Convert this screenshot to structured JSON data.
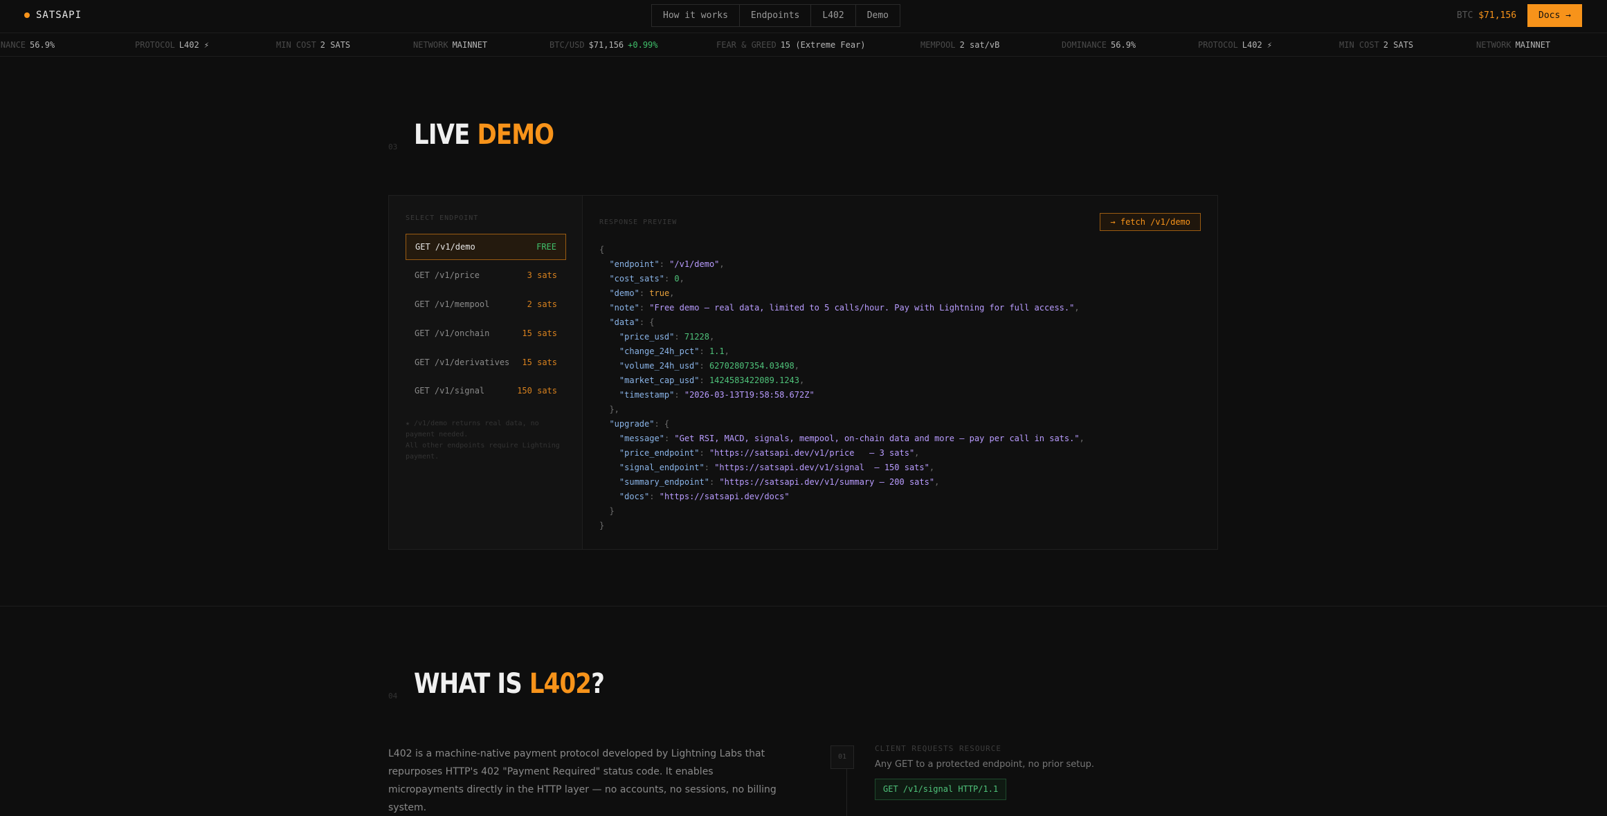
{
  "nav": {
    "brand": "SATSAPI",
    "links": [
      "How it works",
      "Endpoints",
      "L402",
      "Demo"
    ],
    "btc_label": "BTC",
    "btc_value": "$71,156",
    "docs_label": "Docs →"
  },
  "ticker": [
    {
      "k": "DOMINANCE",
      "v": "56.9%"
    },
    {
      "k": "PROTOCOL",
      "v": "L402 ⚡"
    },
    {
      "k": "MIN COST",
      "v": "2 SATS"
    },
    {
      "k": "NETWORK",
      "v": "MAINNET"
    },
    {
      "k": "BTC/USD",
      "v": "$71,156",
      "c": "+0.99%"
    },
    {
      "k": "FEAR & GREED",
      "v": "15 (Extreme Fear)"
    },
    {
      "k": "MEMPOOL",
      "v": "2 sat/vB"
    },
    {
      "k": "DOMINANCE",
      "v": "56.9%"
    },
    {
      "k": "PROTOCOL",
      "v": "L402 ⚡"
    },
    {
      "k": "MIN COST",
      "v": "2 SATS"
    },
    {
      "k": "NETWORK",
      "v": "MAINNET"
    }
  ],
  "demo": {
    "num": "03",
    "title_a": "LIVE",
    "title_b": "DEMO",
    "select_label": "SELECT ENDPOINT",
    "endpoints": [
      {
        "path": "GET /v1/demo",
        "cost": "FREE"
      },
      {
        "path": "GET /v1/price",
        "cost": "3 sats"
      },
      {
        "path": "GET /v1/mempool",
        "cost": "2 sats"
      },
      {
        "path": "GET /v1/onchain",
        "cost": "15 sats"
      },
      {
        "path": "GET /v1/derivatives",
        "cost": "15 sats"
      },
      {
        "path": "GET /v1/signal",
        "cost": "150 sats"
      }
    ],
    "note_1": "★ /v1/demo returns real data, no payment needed.",
    "note_2": "All other endpoints require Lightning payment.",
    "response_label": "RESPONSE PREVIEW",
    "fetch_label": "→ fetch /v1/demo",
    "json": {
      "endpoint": "\"/v1/demo\"",
      "cost_sats": "0",
      "demo": "true",
      "note": "\"Free demo — real data, limited to 5 calls/hour. Pay with Lightning for full access.\"",
      "price_usd": "71228",
      "change_24h_pct": "1.1",
      "volume_24h_usd": "62702807354.03498",
      "market_cap_usd": "1424583422089.1243",
      "timestamp": "\"2026-03-13T19:58:58.672Z\"",
      "message": "\"Get RSI, MACD, signals, mempool, on-chain data and more — pay per call in sats.\"",
      "price_endpoint": "\"https://satsapi.dev/v1/price   — 3 sats\"",
      "signal_endpoint": "\"https://satsapi.dev/v1/signal  — 150 sats\"",
      "summary_endpoint": "\"https://satsapi.dev/v1/summary — 200 sats\"",
      "docs": "\"https://satsapi.dev/docs\""
    }
  },
  "l402": {
    "num": "04",
    "title_a": "WHAT IS",
    "title_b": "L402",
    "title_c": "?",
    "text": "L402 is a machine-native payment protocol developed by Lightning Labs that repurposes HTTP's 402 \"Payment Required\" status code. It enables micropayments directly in the HTTP layer — no accounts, no sessions, no billing system.",
    "step_num": "01",
    "step_label": "CLIENT REQUESTS RESOURCE",
    "step_desc": "Any GET to a protected endpoint, no prior setup.",
    "step_code": "GET /v1/signal HTTP/1.1"
  },
  "colors": {
    "accent": "#f7931a",
    "green": "#3fbf6a",
    "bg": "#0e0e0e"
  }
}
